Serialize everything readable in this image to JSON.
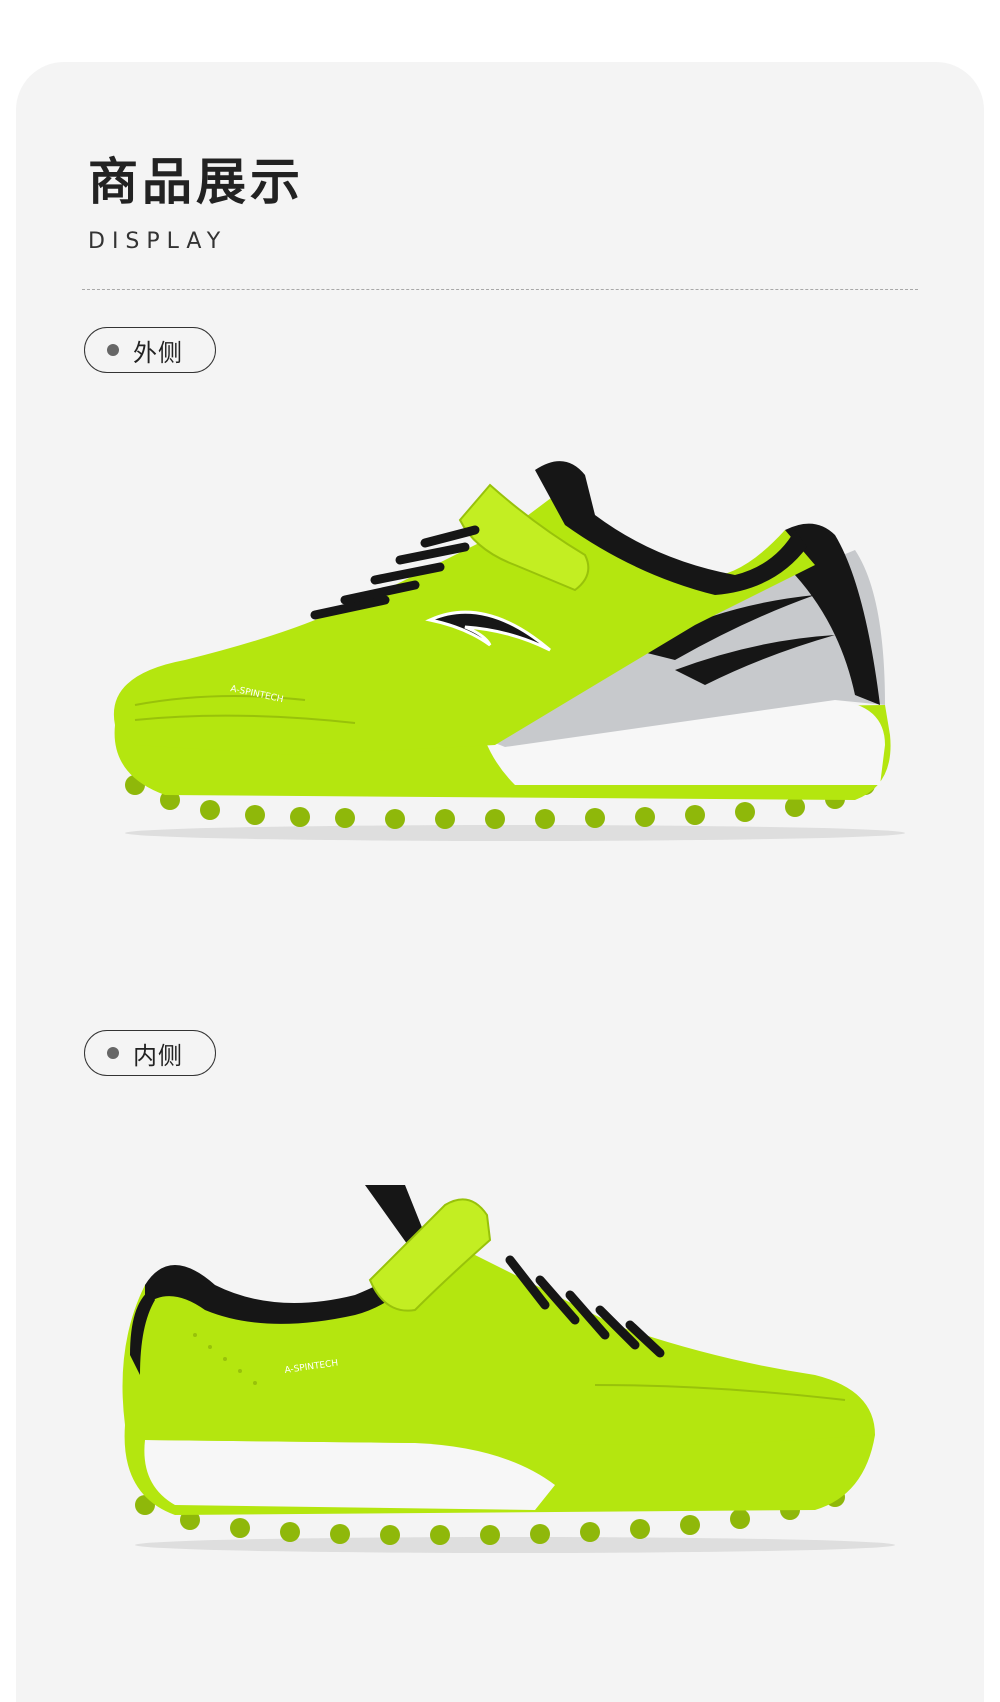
{
  "section": {
    "title": "商品展示",
    "subtitle": "DISPLAY"
  },
  "views": [
    {
      "label": "外侧",
      "image": "lime green junior turf soccer shoe, lateral side, hook-and-loop strap, black laces, silver heel panel"
    },
    {
      "label": "内侧",
      "image": "lime green junior turf soccer shoe, medial side, hook-and-loop strap, white midsole"
    }
  ],
  "shoe_text": {
    "lateral_tech": "A-SPINTECH",
    "medial_tech": "A-SPINTECH"
  },
  "colors": {
    "lime": "#b4e60f",
    "lime_dark": "#98c20a",
    "black": "#161616",
    "silver": "#c7c9cc",
    "white": "#f7f7f7",
    "card": "#f4f4f4"
  }
}
